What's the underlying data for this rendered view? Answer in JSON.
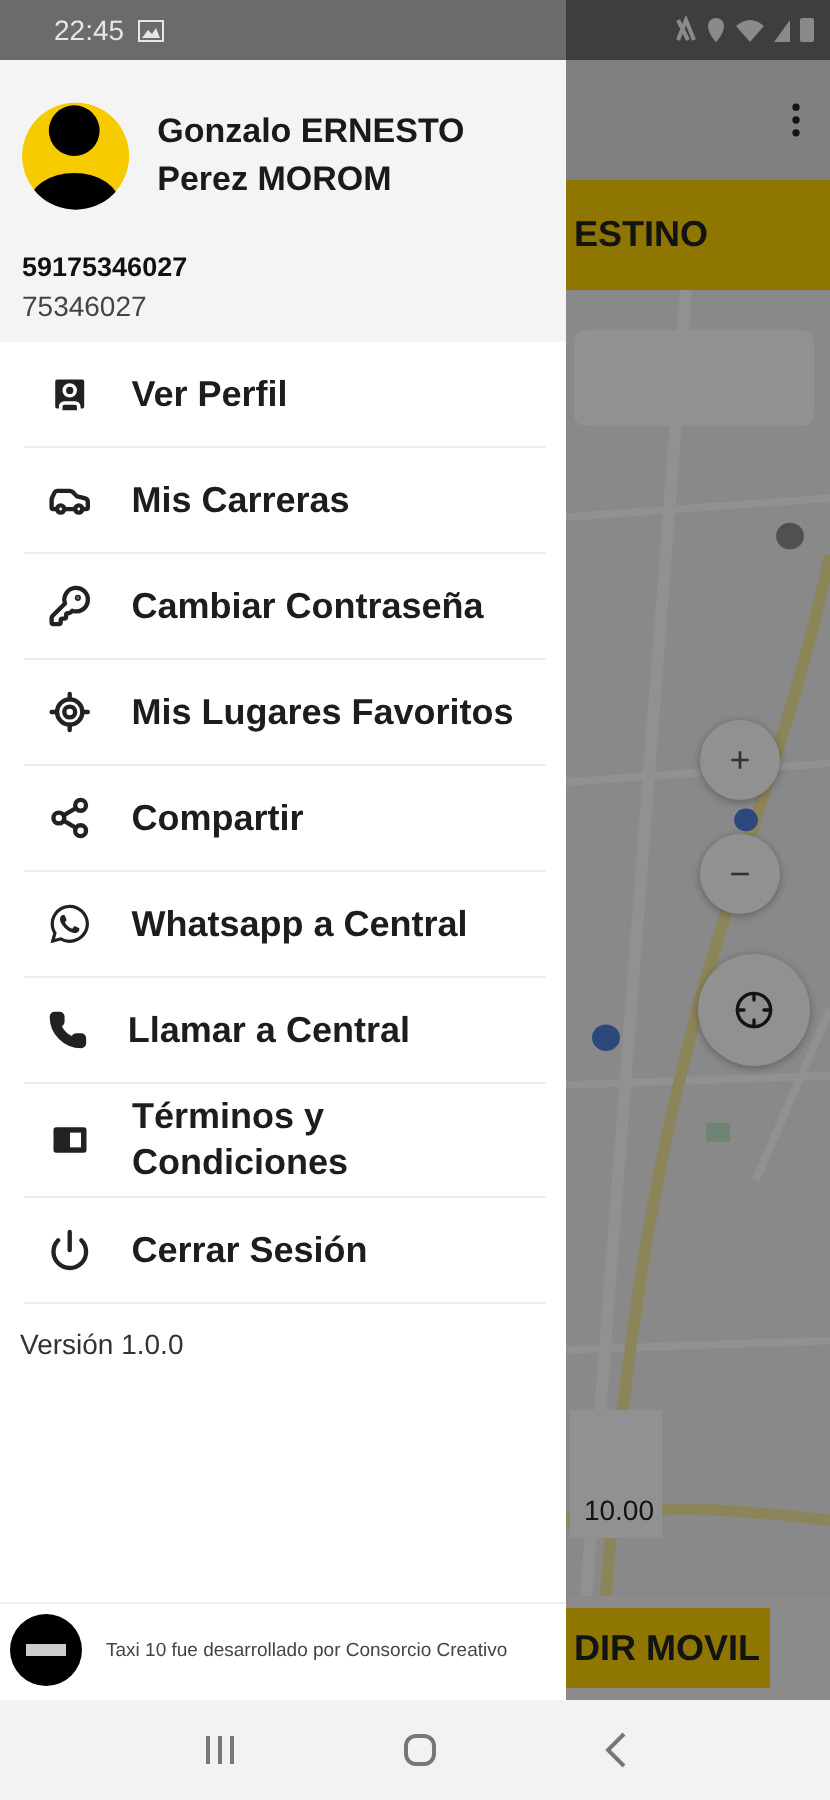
{
  "status_bar": {
    "time": "22:45"
  },
  "profile": {
    "name": "Gonzalo ERNESTO Perez MOROM",
    "phone_full": "59175346027",
    "phone": "75346027"
  },
  "menu": [
    {
      "label": "Ver Perfil"
    },
    {
      "label": "Mis Carreras"
    },
    {
      "label": "Cambiar Contraseña"
    },
    {
      "label": "Mis Lugares Favoritos"
    },
    {
      "label": "Compartir"
    },
    {
      "label": "Whatsapp a Central"
    },
    {
      "label": "Llamar a Central"
    },
    {
      "label": "Términos y Condiciones"
    },
    {
      "label": "Cerrar Sesión"
    }
  ],
  "version": "Versión 1.0.0",
  "footer": {
    "credit": "Taxi 10 fue desarrollado por Consorcio Creativo"
  },
  "background_app": {
    "destination_button": "ESTINO",
    "zoom_in": "+",
    "zoom_out": "−",
    "fare": "10.00",
    "request_button": "DIR MOVIL"
  }
}
